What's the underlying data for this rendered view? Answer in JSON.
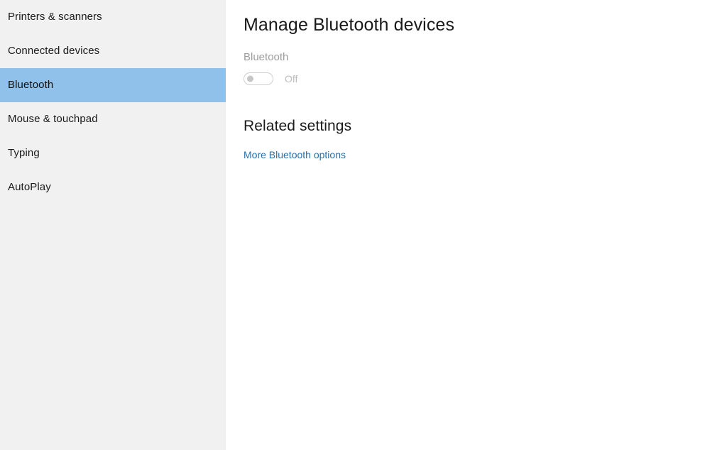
{
  "sidebar": {
    "items": [
      {
        "label": "Printers & scanners",
        "selected": false
      },
      {
        "label": "Connected devices",
        "selected": false
      },
      {
        "label": "Bluetooth",
        "selected": true
      },
      {
        "label": "Mouse & touchpad",
        "selected": false
      },
      {
        "label": "Typing",
        "selected": false
      },
      {
        "label": "AutoPlay",
        "selected": false
      }
    ],
    "selected_color": "#8fc1ea",
    "background_color": "#f1f1f1"
  },
  "main": {
    "title": "Manage Bluetooth devices",
    "bluetooth": {
      "label": "Bluetooth",
      "toggle_state": "Off",
      "toggle_on": false,
      "disabled": true
    },
    "related": {
      "heading": "Related settings",
      "links": [
        {
          "label": "More Bluetooth options"
        }
      ],
      "link_color": "#2a6fa8"
    }
  }
}
